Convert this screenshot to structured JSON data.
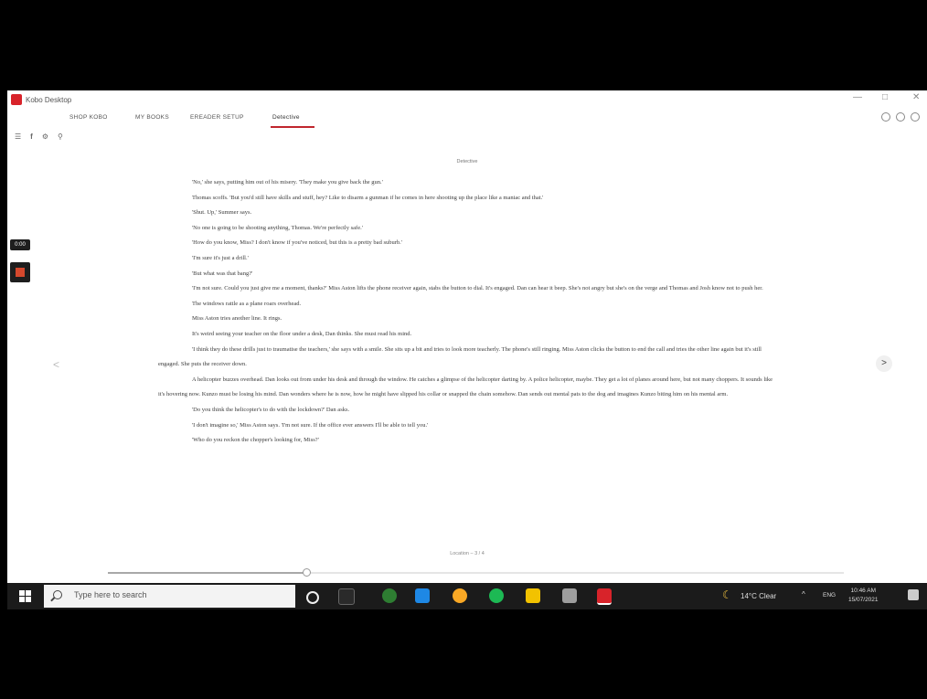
{
  "window": {
    "title": "Kobo Desktop"
  },
  "nav": {
    "items": [
      "SHOP KOBO",
      "MY BOOKS",
      "EREADER SETUP",
      "Detective"
    ]
  },
  "chapter_label": "Detective",
  "paragraphs": [
    "'No,' she says, putting him out of his misery. 'They make you give back the gun.'",
    "Thomas scoffs. 'But you'd still have skills and stuff, hey? Like to disarm a gunman if he comes in here shooting up the place like a maniac and that.'",
    "'Shut. Up,' Summer says.",
    "'No one is going to be shooting anything, Thomas. We're perfectly safe.'",
    "'How do you know, Miss? I don't know if you've noticed, but this is a pretty bad suburb.'",
    "'I'm sure it's just a drill.'",
    "'But what was that bang?'",
    "'I'm not sure. Could you just give me a moment, thanks?' Miss Aston lifts the phone receiver again, stabs the button to dial. It's engaged. Dan can hear it beep. She's not angry but she's on the verge and Thomas and Josh know not to push her.",
    "The windows rattle as a plane roars overhead.",
    "Miss Aston tries another line. It rings.",
    "It's weird seeing your teacher on the floor under a desk, Dan thinks. She must read his mind.",
    "'I think they do these drills just to traumatise the teachers,' she says with a smile. She sits up a bit and tries to look more teacherly. The phone's still ringing. Miss Aston clicks the button to end the call and tries the other line again but it's still engaged. She puts the receiver down.",
    "A helicopter buzzes overhead. Dan looks out from under his desk and through the window. He catches a glimpse of the helicopter darting by. A police helicopter, maybe. They get a lot of planes around here, but not many choppers. It sounds like it's hovering now. Kunzo must be losing his mind. Dan wonders where he is now, how he might have slipped his collar or snapped the chain somehow. Dan sends out mental pats to the dog and imagines Kunzo biting him on his mental arm.",
    "'Do you think the helicopter's to do with the lockdown?' Dan asks.",
    "'I don't imagine so,' Miss Aston says. 'I'm not sure. If the office ever answers I'll be able to tell you.'",
    "'Who do you reckon the chopper's looking for, Miss?'"
  ],
  "side": {
    "timer": "0:00"
  },
  "page_info": "Location ‒ 3 / 4",
  "progress": {
    "value": 0.27
  },
  "taskbar": {
    "search_placeholder": "Type here to search",
    "weather": "14°C Clear",
    "language": "ENG",
    "time": "10:46 AM",
    "date": "15/07/2021"
  },
  "colors": {
    "accent": "#c0262d",
    "taskbar": "#1b1b1b"
  }
}
